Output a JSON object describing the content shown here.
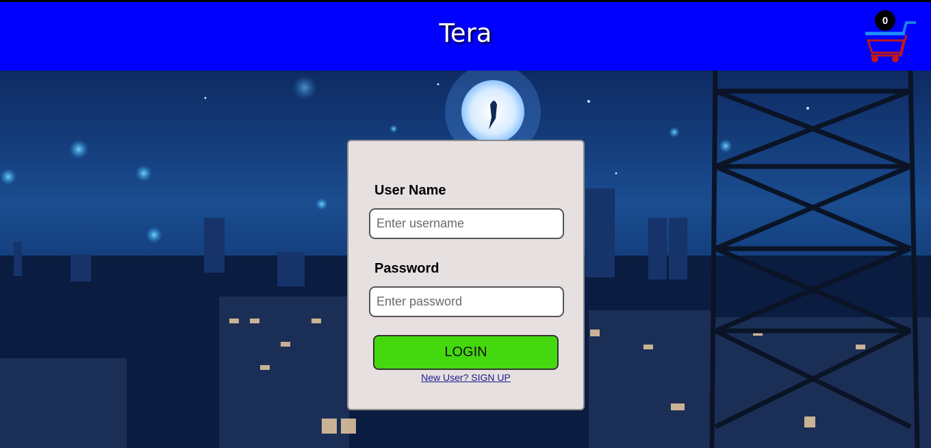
{
  "header": {
    "title": "Tera",
    "cart_count": "0",
    "bg_color": "#0000ff"
  },
  "login": {
    "username_label": "User Name",
    "username_placeholder": "Enter username",
    "password_label": "Password",
    "password_placeholder": "Enter password",
    "login_button": "LOGIN",
    "signup_link": "New User? SIGN UP",
    "button_color": "#44d80f"
  },
  "icons": [
    "shopping-cart-icon"
  ]
}
